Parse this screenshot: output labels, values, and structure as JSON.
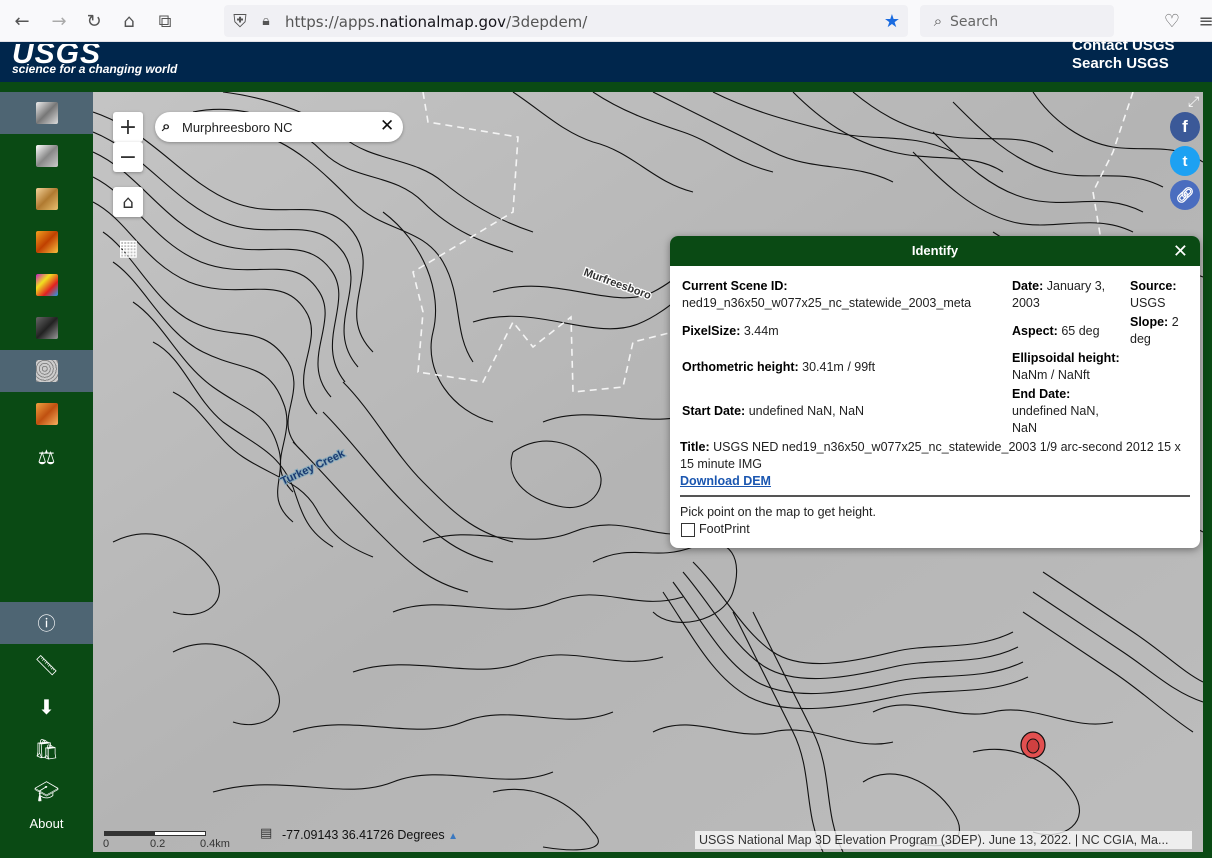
{
  "browser": {
    "url_prefix": "https://apps.",
    "url_host": "nationalmap.gov",
    "url_path": "/3depdem/",
    "search_placeholder": "Search"
  },
  "header": {
    "logo_text": "USGS",
    "tagline": "science for a changing world",
    "links": [
      "Contact USGS",
      "Search USGS"
    ]
  },
  "sidebar": {
    "about_label": "About"
  },
  "map": {
    "search_value": "Murphreesboro  NC",
    "labels": [
      "Murfreesboro",
      "Turkey Creek"
    ],
    "coords": "-77.09143  36.41726 Degrees",
    "scale_labels": [
      "0",
      "0.2",
      "0.4km"
    ],
    "attribution": "USGS National Map 3D Elevation Program (3DEP). June 13, 2022. | NC CGIA, Ma..."
  },
  "identify": {
    "title": "Identify",
    "scene_id_label": "Current Scene ID:",
    "scene_id_value": "ned19_n36x50_w077x25_nc_statewide_2003_meta",
    "date_label": "Date:",
    "date_value": "January 3, 2003",
    "source_label": "Source:",
    "source_value": "USGS",
    "pixelsize_label": "PixelSize:",
    "pixelsize_value": "3.44m",
    "aspect_label": "Aspect:",
    "aspect_value": "65 deg",
    "slope_label": "Slope:",
    "slope_value": "2 deg",
    "ortho_label": "Orthometric height:",
    "ortho_value": "30.41m / 99ft",
    "ellip_label": "Ellipsoidal height:",
    "ellip_value": "NaNm / NaNft",
    "start_label": "Start Date:",
    "start_value": "undefined NaN, NaN",
    "end_label": "End Date:",
    "end_value": "undefined NaN, NaN",
    "title_label": "Title:",
    "title_value": "USGS NED ned19_n36x50_w077x25_nc_statewide_2003 1/9 arc-second 2012 15 x 15 minute IMG",
    "download_label": "Download DEM",
    "pick_text": "Pick point on the map to get height.",
    "footprint_label": "FootPrint"
  },
  "colors": {
    "header_blue": "#00264c",
    "sidebar_green": "#0a4a14",
    "active_item": "#4e6573",
    "link_blue": "#1a56b0"
  }
}
